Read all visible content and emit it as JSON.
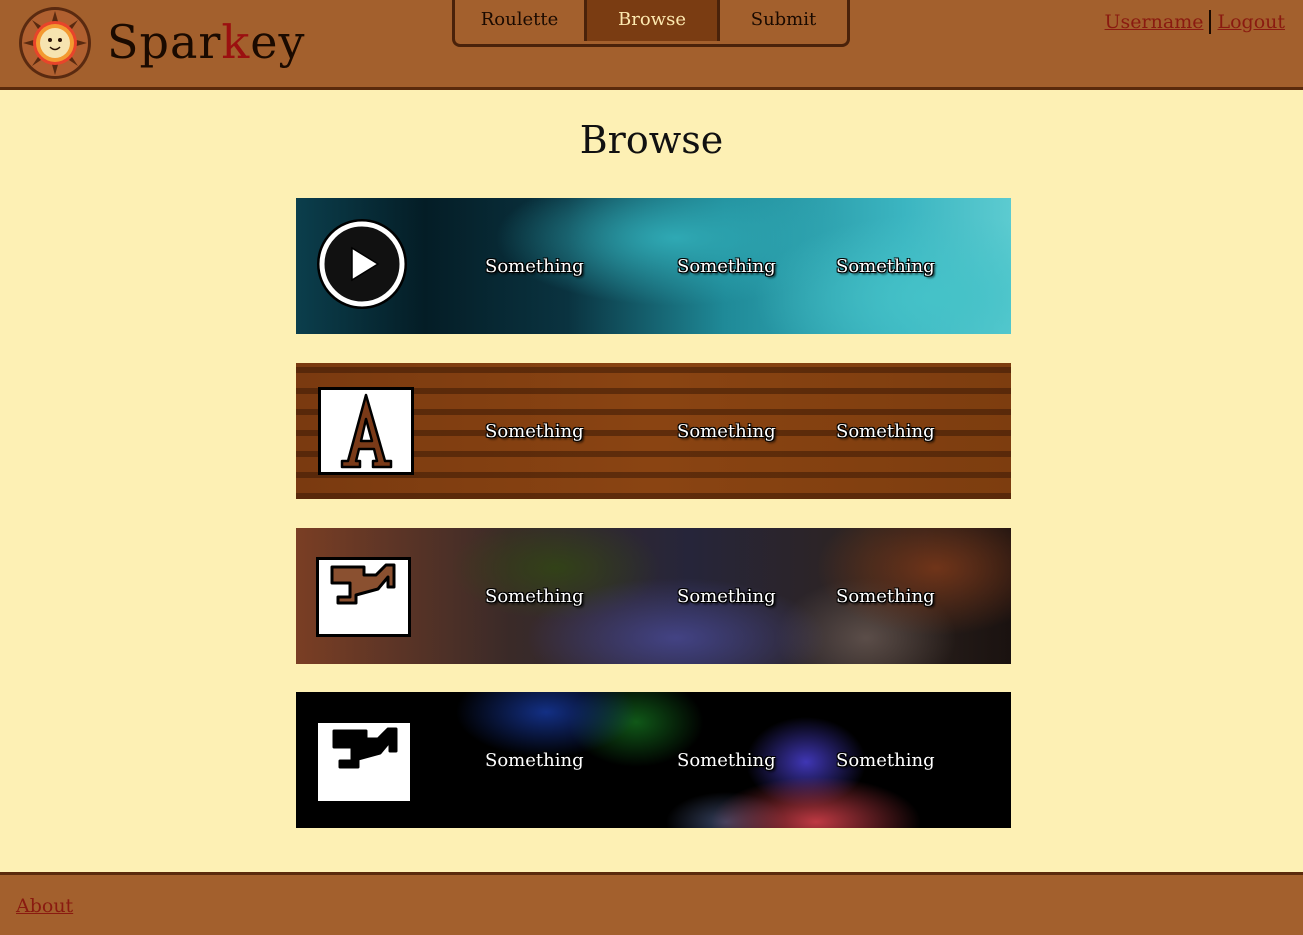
{
  "header": {
    "brand_start": "Spar",
    "brand_k": "k",
    "brand_end": "ey",
    "logo_icon": "sun-face-logo",
    "tabs": [
      {
        "label": "Roulette",
        "active": false
      },
      {
        "label": "Browse",
        "active": true
      },
      {
        "label": "Submit",
        "active": false
      }
    ],
    "username_link": "Username",
    "logout_link": "Logout"
  },
  "main": {
    "title": "Browse",
    "cards": [
      {
        "thumb_icon": "play-icon",
        "background": "teal-blur",
        "cells": [
          "Something",
          "Something",
          "Something"
        ]
      },
      {
        "thumb_icon": "text-letter-a-icon",
        "background": "brown-text-blur",
        "cells": [
          "Something",
          "Something",
          "Something"
        ]
      },
      {
        "thumb_icon": "image-icon",
        "background": "brown-purple-blur",
        "cells": [
          "Something",
          "Something",
          "Something"
        ]
      },
      {
        "thumb_icon": "image-icon",
        "background": "dark-colored-blur",
        "cells": [
          "Something",
          "Something",
          "Something"
        ]
      }
    ]
  },
  "footer": {
    "about_link": "About"
  },
  "colors": {
    "header_bg": "#a3602d",
    "page_bg": "#fdf0b4",
    "link": "#8a1a10",
    "active_tab": "#7a3c12",
    "brand_k": "#9b1010"
  }
}
